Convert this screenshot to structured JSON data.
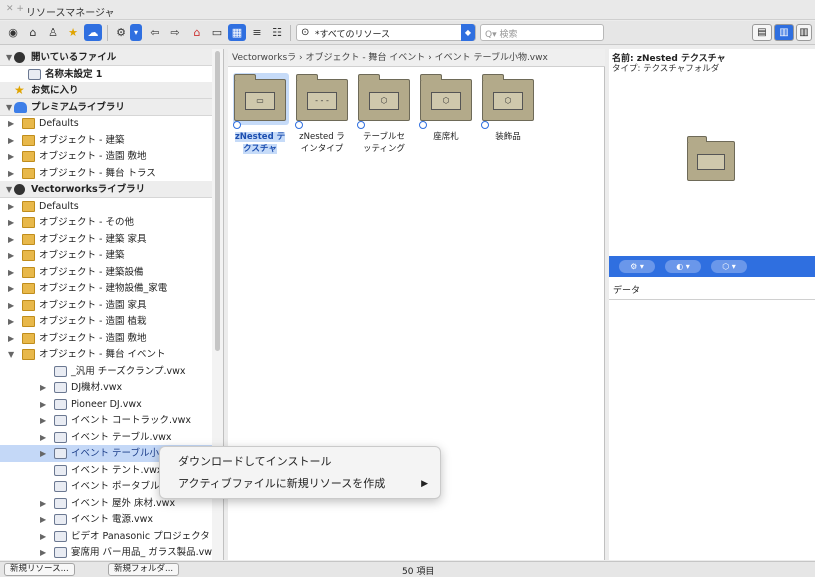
{
  "window": {
    "title": "リソースマネージャ"
  },
  "toolbar": {
    "filter_value": "*すべてのリソース",
    "search_placeholder": "検索"
  },
  "left_tree": [
    {
      "text": "開いているファイル",
      "kind": "header",
      "icon": "vectorworks-icon",
      "arrow": "▼"
    },
    {
      "text": "名称未設定 1",
      "kind": "file-bold",
      "icon": "file-icon",
      "arrow": ""
    },
    {
      "text": "お気に入り",
      "kind": "header",
      "icon": "star-icon",
      "arrow": ""
    },
    {
      "text": "プレミアムライブラリ",
      "kind": "header",
      "icon": "cloud-icon",
      "arrow": "▼"
    },
    {
      "text": "Defaults",
      "kind": "item",
      "icon": "folder-icon",
      "arrow": "▶"
    },
    {
      "text": "オブジェクト - 建築",
      "kind": "item",
      "icon": "folder-icon",
      "arrow": "▶"
    },
    {
      "text": "オブジェクト - 造園 敷地",
      "kind": "item",
      "icon": "folder-icon",
      "arrow": "▶"
    },
    {
      "text": "オブジェクト - 舞台 トラス",
      "kind": "item",
      "icon": "folder-icon",
      "arrow": "▶"
    },
    {
      "text": "Vectorworksライブラリ",
      "kind": "header",
      "icon": "vectorworks-icon",
      "arrow": "▼"
    },
    {
      "text": "Defaults",
      "kind": "item",
      "icon": "folder-icon",
      "arrow": "▶"
    },
    {
      "text": "オブジェクト - その他",
      "kind": "item",
      "icon": "folder-icon",
      "arrow": "▶"
    },
    {
      "text": "オブジェクト - 建築 家具",
      "kind": "item",
      "icon": "folder-icon",
      "arrow": "▶"
    },
    {
      "text": "オブジェクト - 建築",
      "kind": "item",
      "icon": "folder-icon",
      "arrow": "▶"
    },
    {
      "text": "オブジェクト - 建築設備",
      "kind": "item",
      "icon": "folder-icon",
      "arrow": "▶"
    },
    {
      "text": "オブジェクト - 建物設備_家電",
      "kind": "item",
      "icon": "folder-icon",
      "arrow": "▶"
    },
    {
      "text": "オブジェクト - 造園 家具",
      "kind": "item",
      "icon": "folder-icon",
      "arrow": "▶"
    },
    {
      "text": "オブジェクト - 造園 植栽",
      "kind": "item",
      "icon": "folder-icon",
      "arrow": "▶"
    },
    {
      "text": "オブジェクト - 造園 敷地",
      "kind": "item",
      "icon": "folder-icon",
      "arrow": "▶"
    },
    {
      "text": "オブジェクト - 舞台 イベント",
      "kind": "item",
      "icon": "folder-open-icon",
      "arrow": "▼"
    },
    {
      "text": "_汎用 チーズクランプ.vwx",
      "kind": "sub",
      "icon": "vwx-file-icon",
      "arrow": ""
    },
    {
      "text": "DJ機材.vwx",
      "kind": "sub",
      "icon": "vwx-file-icon",
      "arrow": "▶"
    },
    {
      "text": "Pioneer DJ.vwx",
      "kind": "sub",
      "icon": "vwx-file-icon",
      "arrow": "▶"
    },
    {
      "text": "イベント コートラック.vwx",
      "kind": "sub",
      "icon": "vwx-file-icon",
      "arrow": "▶"
    },
    {
      "text": "イベント テーブル.vwx",
      "kind": "sub",
      "icon": "vwx-local-file-icon",
      "arrow": "▶"
    },
    {
      "text": "イベント テーブル小",
      "kind": "sub-selected",
      "icon": "vwx-file-icon",
      "arrow": "▶"
    },
    {
      "text": "イベント テント.vwx",
      "kind": "sub",
      "icon": "vwx-file-icon",
      "arrow": ""
    },
    {
      "text": "イベント ポータブル",
      "kind": "sub",
      "icon": "vwx-file-icon",
      "arrow": ""
    },
    {
      "text": "イベント 屋外 床材.vwx",
      "kind": "sub",
      "icon": "vwx-file-icon",
      "arrow": "▶"
    },
    {
      "text": "イベント 電源.vwx",
      "kind": "sub",
      "icon": "vwx-file-icon",
      "arrow": "▶"
    },
    {
      "text": "ビデオ Panasonic プロジェクタ",
      "kind": "sub",
      "icon": "vwx-file-icon",
      "arrow": "▶"
    },
    {
      "text": "宴席用 バー用品_ ガラス製品.vw",
      "kind": "sub",
      "icon": "vwx-file-icon",
      "arrow": "▶"
    }
  ],
  "breadcrumb": "Vectorworksラ › オブジェクト - 舞台 イベント › イベント テーブル小物.vwx",
  "tiles": [
    {
      "line1": "zNested テ",
      "line2": "クスチャ",
      "inner": "▭",
      "selected": true
    },
    {
      "line1": "zNested ラ",
      "line2": "インタイプ",
      "inner": "- - -",
      "selected": false
    },
    {
      "line1": "テーブルセ",
      "line2": "ッティング",
      "inner": "⬡",
      "selected": false
    },
    {
      "line1": "座席札",
      "line2": "",
      "inner": "⬡",
      "selected": false
    },
    {
      "line1": "装飾品",
      "line2": "",
      "inner": "⬡",
      "selected": false
    }
  ],
  "info": {
    "name": "名前: zNested テクスチャ",
    "type": "タイプ: テクスチャフォルダ",
    "data_label": "データ"
  },
  "context_menu": [
    {
      "label": "ダウンロードしてインストール",
      "submenu": false
    },
    {
      "label": "アクティブファイルに新規リソースを作成",
      "submenu": true
    }
  ],
  "footer": {
    "new_resource": "新規リソース...",
    "new_folder": "新規フォルダ...",
    "count": "50 項目"
  },
  "colors": {
    "accent": "#2f6fe0",
    "folder": "#e8b84a",
    "resource_folder": "#b3aa8a"
  }
}
